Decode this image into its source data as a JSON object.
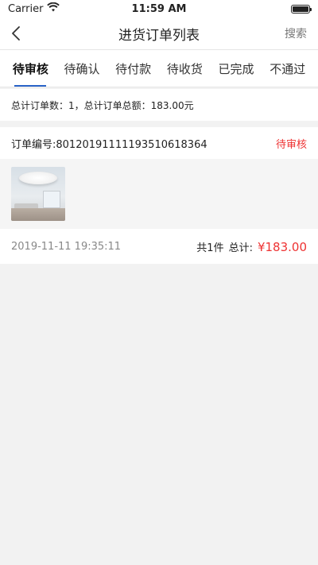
{
  "status_bar": {
    "carrier": "Carrier",
    "time": "11:59 AM"
  },
  "nav": {
    "title": "进货订单列表",
    "search_label": "搜索"
  },
  "tabs": [
    {
      "label": "待审核",
      "active": true
    },
    {
      "label": "待确认",
      "active": false
    },
    {
      "label": "待付款",
      "active": false
    },
    {
      "label": "待收货",
      "active": false
    },
    {
      "label": "已完成",
      "active": false
    },
    {
      "label": "不通过",
      "active": false
    }
  ],
  "summary": "总计订单数：1，总计订单总额：183.00元",
  "order": {
    "number": "订单编号:80120191111193510618364",
    "status": "待审核",
    "time": "2019-11-11 19:35:11",
    "count": "共1件",
    "total_label": "总计:",
    "total": "¥183.00"
  },
  "colors": {
    "accent": "#2a64c8",
    "price_red": "#e33333"
  }
}
